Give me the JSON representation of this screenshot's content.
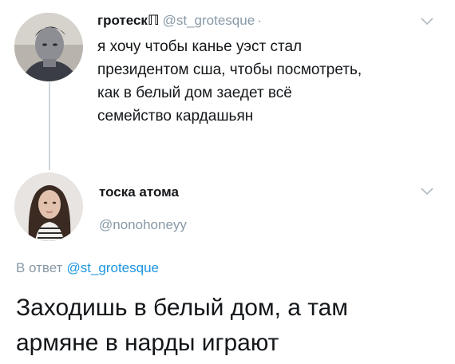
{
  "tweet1": {
    "name": "гротескℿ",
    "handle": "@st_grotesque",
    "separator": "·",
    "text_lines": [
      "я хочу чтобы канье уэст стал",
      "президентом сша, чтобы посмотреть,",
      "как в белый дом заедет всё",
      "семейство кардашьян"
    ],
    "avatar_icon": "user-avatar-photo",
    "menu_icon": "chevron-down-icon"
  },
  "tweet2": {
    "name": "тоска атома",
    "handle": "@nonohoneyy",
    "reply_label": "В ответ",
    "reply_mention": "@st_grotesque",
    "text_lines": [
      "Заходишь в белый дом, а там",
      "армяне в нарды играют"
    ],
    "avatar_icon": "user-avatar-photo",
    "menu_icon": "chevron-down-icon"
  },
  "colors": {
    "text": "#14171a",
    "secondary": "#8899a6",
    "link": "#1b95e0",
    "thread_line": "#ccd6dd"
  }
}
